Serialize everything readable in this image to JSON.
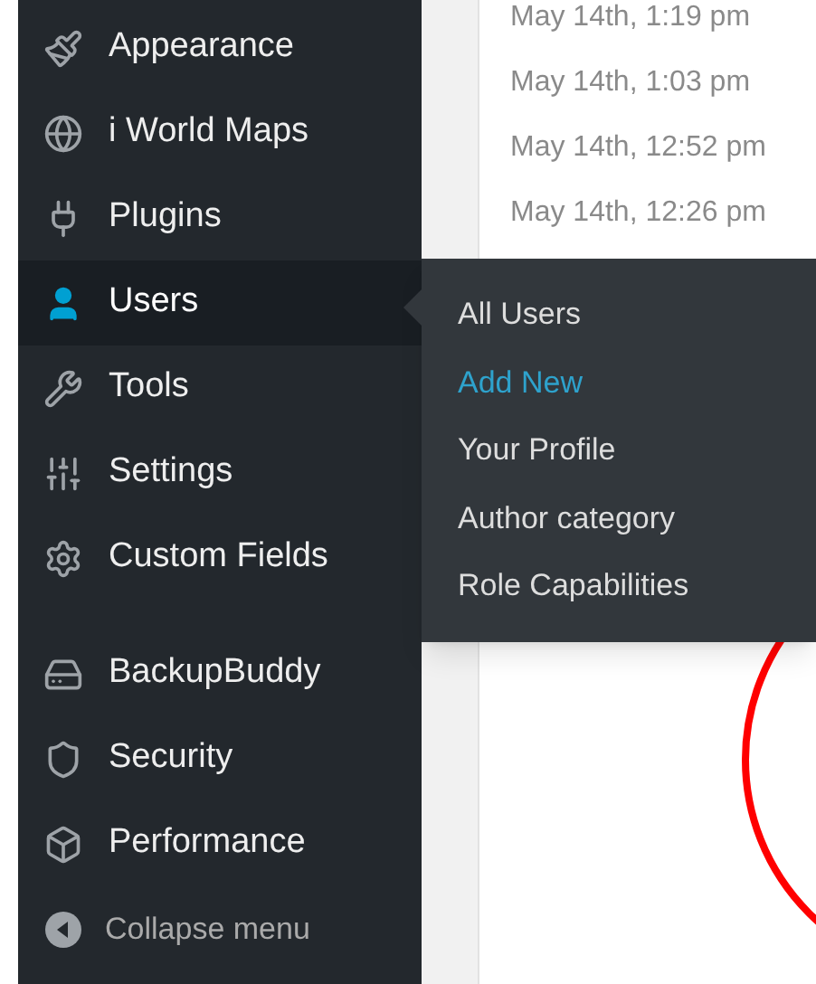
{
  "sidebar": {
    "groups": [
      {
        "items": [
          {
            "label": "Appearance",
            "selected": false
          },
          {
            "label": "i World Maps",
            "selected": false
          },
          {
            "label": "Plugins",
            "selected": false
          },
          {
            "label": "Users",
            "selected": true
          },
          {
            "label": "Tools",
            "selected": false
          },
          {
            "label": "Settings",
            "selected": false
          },
          {
            "label": "Custom Fields",
            "selected": false
          }
        ]
      },
      {
        "items": [
          {
            "label": "BackupBuddy",
            "selected": false
          },
          {
            "label": "Security",
            "selected": false
          },
          {
            "label": "Performance",
            "selected": false
          }
        ]
      }
    ],
    "collapse_button": "Collapse menu"
  },
  "submenu": {
    "items": [
      {
        "label": "All Users",
        "selected": false
      },
      {
        "label": "Add New",
        "selected": true
      },
      {
        "label": "Your Profile",
        "selected": false
      },
      {
        "label": "Author category",
        "selected": false
      },
      {
        "label": "Role Capabilities",
        "selected": false
      }
    ]
  },
  "content": {
    "timestamps": [
      "May 14th, 1:19 pm",
      "May 14th, 1:03 pm",
      "May 14th, 12:52 pm",
      "May 14th, 12:26 pm"
    ]
  }
}
